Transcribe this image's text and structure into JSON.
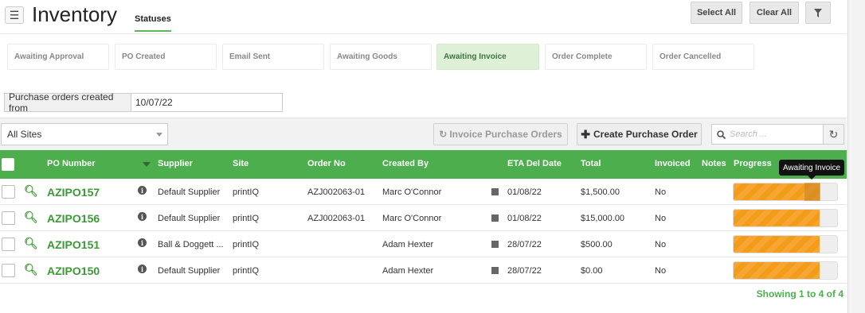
{
  "header": {
    "title": "Inventory",
    "tab": "Statuses",
    "select_all": "Select All",
    "clear_all": "Clear All"
  },
  "statuses": [
    {
      "label": "Awaiting Approval",
      "active": false
    },
    {
      "label": "PO Created",
      "active": false
    },
    {
      "label": "Email Sent",
      "active": false
    },
    {
      "label": "Awaiting Goods",
      "active": false
    },
    {
      "label": "Awaiting Invoice",
      "active": true
    },
    {
      "label": "Order Complete",
      "active": false
    },
    {
      "label": "Order Cancelled",
      "active": false
    }
  ],
  "date_filter": {
    "label": "Purchase orders created from",
    "value": "10/07/22"
  },
  "toolbar": {
    "site_select": "All Sites",
    "invoice_button": "Invoice Purchase Orders",
    "create_button": "Create Purchase Order",
    "search_placeholder": "Search ..."
  },
  "table": {
    "columns": [
      "PO Number",
      "Supplier",
      "Site",
      "Order No",
      "Created By",
      "ETA Del Date",
      "Total",
      "Invoiced",
      "Notes",
      "Progress"
    ],
    "rows": [
      {
        "po": "AZIPO157",
        "supplier": "Default Supplier",
        "site": "printIQ",
        "order_no": "AZJ002063-01",
        "created_by": "Marc O'Connor",
        "eta": "01/08/22",
        "total": "$1,500.00",
        "invoiced": "No",
        "notes": "",
        "progress": 0.83
      },
      {
        "po": "AZIPO156",
        "supplier": "Default Supplier",
        "site": "printIQ",
        "order_no": "AZJ002063-01",
        "created_by": "Marc O'Connor",
        "eta": "01/08/22",
        "total": "$15,000.00",
        "invoiced": "No",
        "notes": "",
        "progress": 0.83
      },
      {
        "po": "AZIPO151",
        "supplier": "Ball & Doggett ...",
        "site": "printIQ",
        "order_no": "",
        "created_by": "Adam Hexter",
        "eta": "28/07/22",
        "total": "$500.00",
        "invoiced": "No",
        "notes": "",
        "progress": 0.83
      },
      {
        "po": "AZIPO150",
        "supplier": "Default Supplier",
        "site": "printIQ",
        "order_no": "",
        "created_by": "Adam Hexter",
        "eta": "28/07/22",
        "total": "$0.00",
        "invoiced": "No",
        "notes": "",
        "progress": 0.83
      }
    ]
  },
  "tooltip": "Awaiting Invoice",
  "footer": {
    "showing": "Showing 1 to 4 of 4"
  },
  "icons": {
    "menu": "hamburger-icon",
    "filter": "funnel-icon",
    "search": "magnifier-icon",
    "refresh": "refresh-icon",
    "row_zoom": "zoom-icon",
    "info": "info-icon",
    "calendar": "calendar-icon",
    "sort": "chevron-down-icon"
  },
  "colors": {
    "accent": "#4cae4c",
    "active_chip": "#dff0d8",
    "progress": "#f7a632"
  }
}
